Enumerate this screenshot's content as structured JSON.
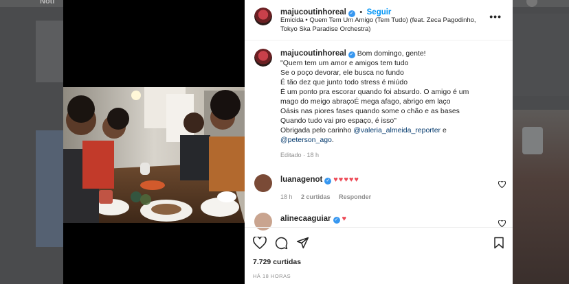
{
  "background": {
    "topbar_text": "Notí"
  },
  "post": {
    "author": "majucoutinhoreal",
    "follow_label": "Seguir",
    "separator": "•",
    "audio_line1": "Emicida • Quem Tem Um Amigo (Tem Tudo) (feat. Zeca Pagodinho,",
    "audio_line2": "Tokyo Ska Paradise Orchestra)",
    "more_label": "•••"
  },
  "caption": {
    "author": "majucoutinhoreal",
    "line1": "Bom domingo, gente!",
    "line2": "\"Quem tem um amor e amigos tem tudo",
    "line3": "Se o poço devorar, ele busca no fundo",
    "line4": "É tão dez que junto todo stress é miúdo",
    "line5": "É um ponto pra escorar quando foi absurdo. O amigo é um",
    "line6": "mago do meigo abraçoÉ mega afago, abrigo em laço",
    "line7": "Oásis nas piores fases quando some o chão e as bases",
    "line8": "Quando tudo vai pro espaço, é isso\"",
    "thanks_prefix": "Obrigada pelo carinho",
    "mention1": "@valeria_almeida_reporter",
    "and_word": "e",
    "mention2": "@peterson_ago",
    "period": ".",
    "edited": "Editado · 18 h"
  },
  "comments": [
    {
      "user": "luanagenot",
      "hearts": "♥♥♥♥♥",
      "age": "18 h",
      "likes": "2 curtidas",
      "reply": "Responder"
    },
    {
      "user": "alinecaaguiar",
      "hearts": "♥"
    }
  ],
  "footer": {
    "likes": "7.729 curtidas",
    "time": "HÁ 18 HORAS"
  },
  "colors": {
    "link": "#0095f6",
    "mention": "#00376b",
    "verified": "#3797f0",
    "heart": "#ed4956",
    "overlay": "#3f4042"
  },
  "icons": {
    "like": "heart-outline-icon",
    "comment": "speech-bubble-icon",
    "share": "paper-plane-icon",
    "save": "bookmark-icon"
  }
}
